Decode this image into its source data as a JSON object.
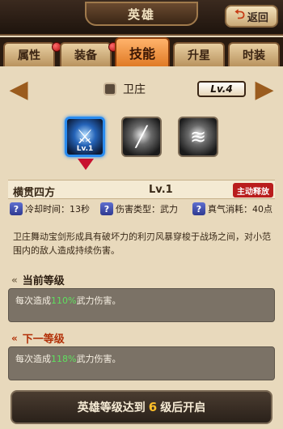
{
  "header": {
    "title": "英雄",
    "back_label": "返回"
  },
  "tabs": [
    {
      "label": "属性",
      "active": false,
      "has_badge": true
    },
    {
      "label": "装备",
      "active": false,
      "has_badge": true
    },
    {
      "label": "技能",
      "active": true,
      "has_badge": false
    },
    {
      "label": "升星",
      "active": false,
      "has_badge": false
    },
    {
      "label": "时装",
      "active": false,
      "has_badge": false
    }
  ],
  "hero": {
    "name": "卫庄",
    "level_badge": "Lv.4"
  },
  "skills": [
    {
      "icon": "sword-icon",
      "level": "Lv.1",
      "active": true
    },
    {
      "icon": "blade-slash-icon",
      "level": "",
      "active": false
    },
    {
      "icon": "whirlwind-icon",
      "level": "",
      "active": false
    }
  ],
  "skill": {
    "name": "横贯四方",
    "level": "Lv.1",
    "tag": "主动释放",
    "cooldown_label": "冷却时间：13秒",
    "damage_type_label": "伤害类型：武力",
    "energy_label": "真气消耗：40点",
    "description": "卫庄舞动宝剑形成具有破坏力的利刃风暴穿梭于战场之间，对小范围内的敌人造成持续伤害。"
  },
  "current_level": {
    "title": "当前等级",
    "prefix": "每次造成",
    "percent": "110%",
    "suffix": "武力伤害。"
  },
  "next_level": {
    "title": "下一等级",
    "prefix": "每次造成",
    "percent": "118%",
    "suffix": "武力伤害。"
  },
  "unlock": {
    "prefix": "英雄等级达到",
    "level": "6",
    "suffix": "级后开启"
  },
  "colors": {
    "accent": "#e07a25",
    "percent": "#5fe15f",
    "tag": "#b91d1d",
    "highlight": "#ffc02a"
  }
}
